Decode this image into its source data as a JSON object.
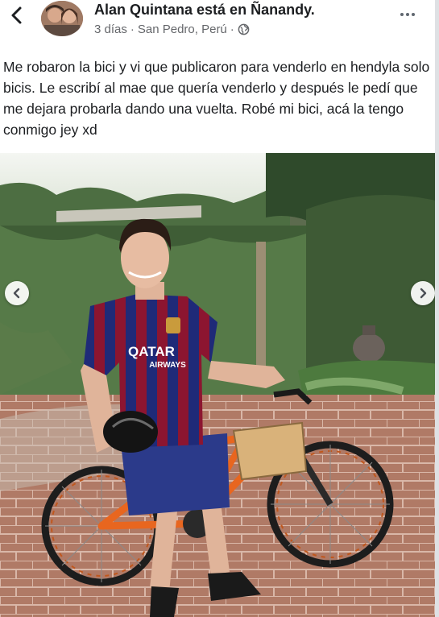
{
  "post": {
    "author": "Alan Quintana",
    "connector": "está en",
    "place": "Ñanandy.",
    "time": "3 días",
    "separator": "·",
    "location": "San Pedro, Perú",
    "separator2": "·",
    "text": "Me robaron la bici y vi que publicaron para venderlo en hendyla solo bicis. Le escribí al mae que quería venderlo y después le pedí que me dejara probarla dando una vuelta. Robé mi bici, acá la tengo conmigo jey xd"
  },
  "photo": {
    "jersey_sponsor_line1": "QATAR",
    "jersey_sponsor_line2": "AIRWAYS"
  },
  "icons": {
    "back": "chevron-left-icon",
    "audience": "globe-icon",
    "more": "more-horizontal-icon",
    "prev": "chevron-left-icon",
    "next": "chevron-right-icon"
  },
  "colors": {
    "text": "#1c1e21",
    "meta": "#65676b",
    "jersey_blue": "#1f2a78",
    "jersey_red": "#8c1530",
    "bike_orange": "#e8661f"
  }
}
